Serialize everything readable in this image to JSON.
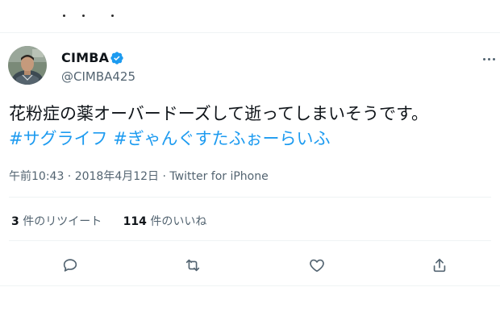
{
  "tweet": {
    "display_name": "CIMBA",
    "handle": "@CIMBA425",
    "text": "花粉症の薬オーバードーズして逝ってしまいそうです。",
    "hashtags": [
      "#サグライフ",
      "#ぎゃんぐすたふぉーらいふ"
    ],
    "timestamp": "午前10:43 · 2018年4月12日 · Twitter for iPhone"
  },
  "stats": {
    "retweets_count": "3",
    "retweets_label": "件のリツイート",
    "likes_count": "114",
    "likes_label": "件のいいね"
  },
  "icons": {
    "verified": "verified-badge-icon",
    "more": "more-options-icon",
    "reply": "reply-icon",
    "retweet": "retweet-icon",
    "like": "heart-icon",
    "share": "share-icon"
  },
  "colors": {
    "accent": "#1d9bf0",
    "secondary_text": "#536471",
    "primary_text": "#0f1419"
  }
}
